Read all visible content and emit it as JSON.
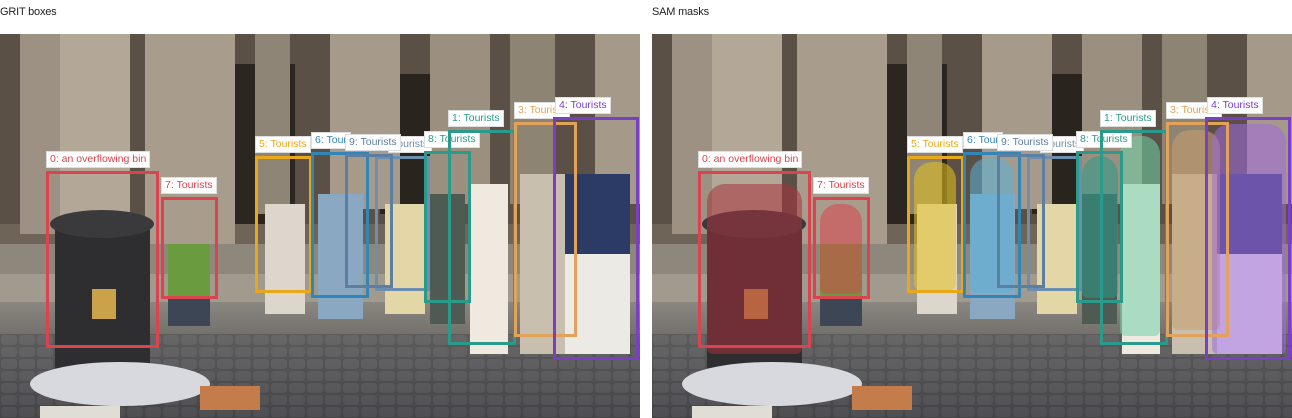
{
  "panels": {
    "left_title": "GRIT boxes",
    "right_title": "SAM masks"
  },
  "detections": [
    {
      "id": 0,
      "label": "0: an overflowing bin",
      "color": "#d9444e"
    },
    {
      "id": 1,
      "label": "1: Tourists",
      "color": "#2a9a8a"
    },
    {
      "id": 2,
      "label": "Tourists",
      "color": "#6c8fb0"
    },
    {
      "id": 3,
      "label": "3: Tourists",
      "color": "#e3a25a"
    },
    {
      "id": 4,
      "label": "4: Tourists",
      "color": "#7b3fc4"
    },
    {
      "id": 5,
      "label": "5: Tourists",
      "color": "#e8a81a"
    },
    {
      "id": 6,
      "label": "6: Tour",
      "color": "#2f86b8"
    },
    {
      "id": 7,
      "label": "7: Tourists",
      "color": "#d9444e"
    },
    {
      "id": 8,
      "label": "8: Tourists",
      "color": "#2a9a8a"
    },
    {
      "id": 9,
      "label": "9: Tourists",
      "color": "#5c7ea0"
    }
  ]
}
